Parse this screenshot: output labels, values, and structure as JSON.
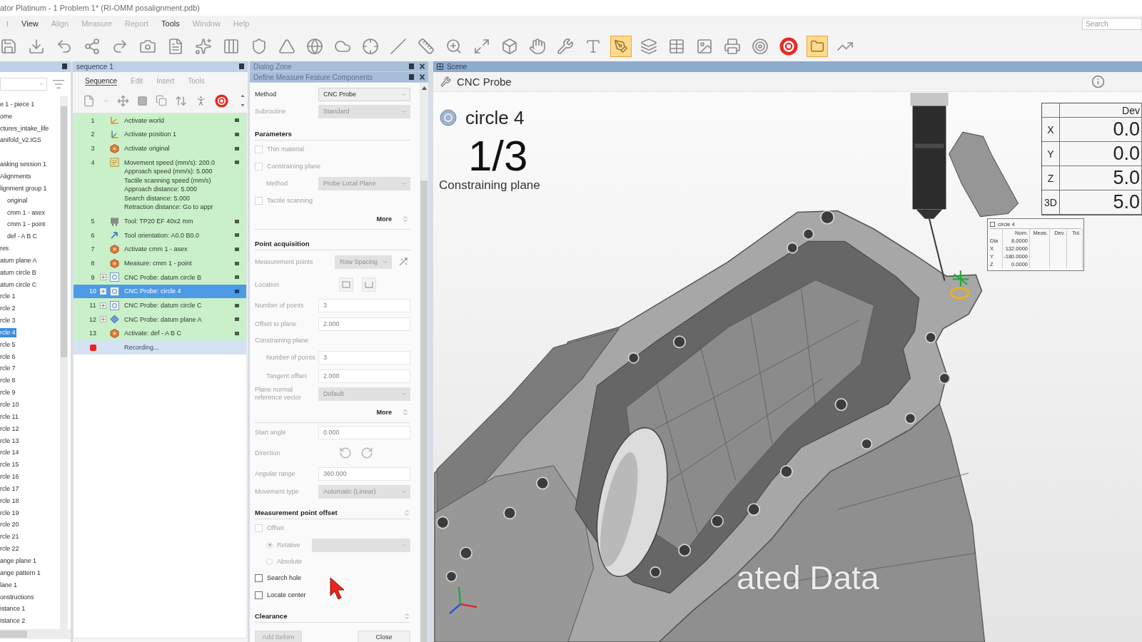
{
  "window": {
    "title": "ator Platinum - 1 Problem 1* (RI-OMM posalignment.pdb)"
  },
  "menu": [
    {
      "label": "t",
      "disabled": true
    },
    {
      "label": "View",
      "disabled": false
    },
    {
      "label": "Align",
      "disabled": true
    },
    {
      "label": "Measure",
      "disabled": true
    },
    {
      "label": "Report",
      "disabled": true
    },
    {
      "label": "Tools",
      "disabled": false
    },
    {
      "label": "Window",
      "disabled": true
    },
    {
      "label": "Help",
      "disabled": true
    }
  ],
  "search": {
    "placeholder": "Search"
  },
  "toolbar": [
    {
      "active": false
    },
    {
      "active": false
    },
    {
      "active": false
    },
    {
      "active": false
    },
    {
      "active": false
    },
    {
      "active": false
    },
    {
      "active": false
    },
    {
      "active": false
    },
    {
      "active": false
    },
    {
      "active": false
    },
    {
      "active": false
    },
    {
      "active": false
    },
    {
      "active": false
    },
    {
      "active": false
    },
    {
      "active": false
    },
    {
      "active": false
    },
    {
      "active": false
    },
    {
      "active": false
    },
    {
      "active": false
    },
    {
      "active": false
    },
    {
      "active": false
    },
    {
      "active": false
    },
    {
      "active": true
    },
    {
      "active": false
    },
    {
      "active": false
    },
    {
      "active": false
    },
    {
      "active": false
    },
    {
      "active": false
    },
    {
      "active": false
    },
    {
      "active": true
    },
    {
      "active": false
    }
  ],
  "explorer": {
    "groups": [
      {
        "items": [
          {
            "label": "e 1 - piece 1",
            "selected": false
          },
          {
            "label": "ome",
            "selected": false
          },
          {
            "label": "ctures_intake_life",
            "selected": false
          },
          {
            "label": "anifold_v2.IGS",
            "selected": false
          }
        ]
      },
      {
        "items": [
          {
            "label": "asking session 1",
            "selected": false
          },
          {
            "label": "Alignments",
            "selected": false
          },
          {
            "label": "lignment group 1",
            "selected": false,
            "children": [
              {
                "label": "original",
                "selected": false
              },
              {
                "label": "cmm 1 - asex",
                "selected": false
              },
              {
                "label": "cmm 1 - point",
                "selected": false
              },
              {
                "label": "def - A B C",
                "selected": false
              }
            ]
          },
          {
            "label": "res",
            "selected": false
          },
          {
            "label": "atum plane A",
            "selected": false
          },
          {
            "label": "atum circle B",
            "selected": false
          },
          {
            "label": "atum circle C",
            "selected": false
          },
          {
            "label": "rcle 1",
            "selected": false
          },
          {
            "label": "rcle 2",
            "selected": false
          },
          {
            "label": "rcle 3",
            "selected": false
          },
          {
            "label": "rcle 4",
            "selected": true
          },
          {
            "label": "rcle 5",
            "selected": false
          },
          {
            "label": "rcle 6",
            "selected": false
          },
          {
            "label": "rcle 7",
            "selected": false
          },
          {
            "label": "rcle 8",
            "selected": false
          },
          {
            "label": "rcle 9",
            "selected": false
          },
          {
            "label": "rcle 10",
            "selected": false
          },
          {
            "label": "rcle 11",
            "selected": false
          },
          {
            "label": "rcle 12",
            "selected": false
          },
          {
            "label": "rcle 13",
            "selected": false
          },
          {
            "label": "rcle 14",
            "selected": false
          },
          {
            "label": "rcle 15",
            "selected": false
          },
          {
            "label": "rcle 16",
            "selected": false
          },
          {
            "label": "rcle 17",
            "selected": false
          },
          {
            "label": "rcle 18",
            "selected": false
          },
          {
            "label": "rcle 19",
            "selected": false
          },
          {
            "label": "rcle 20",
            "selected": false
          },
          {
            "label": "rcle 21",
            "selected": false
          },
          {
            "label": "rcle 22",
            "selected": false
          },
          {
            "label": "ange plane 1",
            "selected": false
          },
          {
            "label": "ange pattern 1",
            "selected": false
          },
          {
            "label": "lane 1",
            "selected": false
          },
          {
            "label": "onstructions",
            "selected": false
          },
          {
            "label": "istance 1",
            "selected": false
          },
          {
            "label": "istance 2",
            "selected": false
          }
        ]
      }
    ]
  },
  "sequence": {
    "title": "sequence 1",
    "tabs": [
      {
        "label": "Sequence",
        "selected": true
      },
      {
        "label": "Edit",
        "selected": false
      },
      {
        "label": "Insert",
        "selected": false
      },
      {
        "label": "Tools",
        "selected": false
      }
    ],
    "steps": [
      {
        "number": "1",
        "lines": [
          "Activate world"
        ],
        "kind": "frame",
        "selected": false
      },
      {
        "number": "2",
        "lines": [
          "Activate position 1"
        ],
        "kind": "position",
        "selected": false
      },
      {
        "number": "3",
        "lines": [
          "Activate original"
        ],
        "kind": "alignment",
        "selected": false
      },
      {
        "number": "4",
        "lines": [
          "Movement speed (mm/s): 200.0",
          "Approach speed (mm/s): 5.000",
          "Tactile scanning speed (mm/s)",
          "Approach distance: 5.000",
          "Search distance: 5.000",
          "Retraction distance: Go to appr"
        ],
        "kind": "settings",
        "selected": false
      },
      {
        "number": "5",
        "lines": [
          "Tool: TP20 EF 40x2 mm"
        ],
        "kind": "tool",
        "selected": false
      },
      {
        "number": "6",
        "lines": [
          "Tool orientation: A0.0 B0.0"
        ],
        "kind": "orientation",
        "selected": false
      },
      {
        "number": "7",
        "lines": [
          "Activate cmm 1 - asex"
        ],
        "kind": "alignment",
        "selected": false
      },
      {
        "number": "8",
        "lines": [
          "Measure: cmm 1 - point"
        ],
        "kind": "alignment",
        "selected": false
      },
      {
        "number": "9",
        "lines": [
          "CNC Probe: datum circle B"
        ],
        "kind": "probe-circle",
        "selected": false
      },
      {
        "number": "10",
        "lines": [
          "CNC Probe: circle 4"
        ],
        "kind": "probe-circle",
        "selected": true
      },
      {
        "number": "11",
        "lines": [
          "CNC Probe: datum circle C"
        ],
        "kind": "probe-circle",
        "selected": false
      },
      {
        "number": "12",
        "lines": [
          "CNC Probe: datum plane A"
        ],
        "kind": "probe-plane",
        "selected": false
      },
      {
        "number": "13",
        "lines": [
          "Activate: def - A B C"
        ],
        "kind": "alignment",
        "selected": false
      }
    ],
    "recording": "Recording..."
  },
  "dialog": {
    "title": "Dialog Zone",
    "subtitle": "Define Measure Feature Components",
    "rows": [
      {
        "kind": "dropdown",
        "label": "Method",
        "value": "CNC Probe",
        "disabled": false
      },
      {
        "kind": "dropdown",
        "label": "Subroutine",
        "value": "Standard",
        "disabled": true
      },
      {
        "kind": "section",
        "label": "Parameters"
      },
      {
        "kind": "checkbox",
        "label": "Thin material",
        "checked": false,
        "disabled": true
      },
      {
        "kind": "checkbox",
        "label": "Constraining plane",
        "checked": false,
        "disabled": true,
        "children": [
          {
            "kind": "dropdown",
            "label": "Method",
            "value": "Probe Local Plane",
            "disabled": true
          }
        ]
      },
      {
        "kind": "checkbox",
        "label": "Tactile scanning",
        "checked": false,
        "disabled": true
      },
      {
        "kind": "more",
        "label": "More"
      },
      {
        "kind": "section",
        "label": "Point acquisition"
      },
      {
        "kind": "picker",
        "label": "Measurement points",
        "value": "Row Spacing",
        "disabled": true
      },
      {
        "kind": "boxes",
        "label": "Location",
        "disabled": true
      },
      {
        "kind": "field",
        "label": "Number of points",
        "value": "3",
        "disabled": true
      },
      {
        "kind": "field",
        "label": "Offset to plane",
        "value": "2.000",
        "disabled": true
      },
      {
        "kind": "group",
        "label": "Constraining plane",
        "disabled": true,
        "children": [
          {
            "kind": "field",
            "label": "Number of points",
            "value": "3",
            "disabled": true
          },
          {
            "kind": "field",
            "label": "Tangent offset",
            "value": "2.000",
            "disabled": true
          }
        ]
      },
      {
        "kind": "dropdown",
        "label": "Plane normal reference vector",
        "value": "Default",
        "disabled": true
      },
      {
        "kind": "more",
        "label": "More"
      },
      {
        "kind": "field",
        "label": "Start angle",
        "value": "0.000",
        "disabled": true
      },
      {
        "kind": "turns",
        "label": "Direction",
        "disabled": true
      },
      {
        "kind": "field",
        "label": "Angular range",
        "value": "360.000",
        "disabled": true
      },
      {
        "kind": "dropdown",
        "label": "Movement type",
        "value": "Automatic (Linear)",
        "disabled": true
      },
      {
        "kind": "fold",
        "label": "Measurement point offset"
      },
      {
        "kind": "checkbox",
        "label": "Offset",
        "checked": false,
        "disabled": true,
        "children": [
          {
            "kind": "radiopick",
            "label": "Relative",
            "selected": true,
            "disabled": true
          },
          {
            "kind": "radio",
            "label": "Absolute",
            "selected": false,
            "disabled": true
          }
        ]
      },
      {
        "kind": "checkbox",
        "label": "Search hole",
        "checked": false,
        "disabled": false
      },
      {
        "kind": "checkbox",
        "label": "Locate center",
        "checked": false,
        "disabled": false
      },
      {
        "kind": "fold",
        "label": "Clearance"
      }
    ],
    "buttons": [
      {
        "label": "Add Before",
        "disabled": true
      },
      {
        "label": "Close",
        "disabled": false
      }
    ]
  },
  "scene": {
    "title": "Scene",
    "tool": "CNC Probe",
    "feature": "circle 4",
    "progress": "1/3",
    "stage": "Constraining plane",
    "overlay": "ated Data",
    "deviation": {
      "header": "Dev",
      "rows": [
        {
          "axis": "X",
          "value": "0.0"
        },
        {
          "axis": "Y",
          "value": "0.0"
        },
        {
          "axis": "Z",
          "value": "5.0"
        },
        {
          "axis": "3D",
          "value": "5.0"
        }
      ]
    },
    "callout": {
      "title": "circle 4",
      "columns": [
        "Nom.",
        "Meas.",
        "Dev.",
        "Tol."
      ],
      "rows": [
        {
          "label": "Dia",
          "nominal": "8.0000"
        },
        {
          "label": "X",
          "nominal": "132.0000"
        },
        {
          "label": "Y",
          "nominal": "-180.0000"
        },
        {
          "label": "Z",
          "nominal": "0.0000"
        }
      ]
    }
  }
}
